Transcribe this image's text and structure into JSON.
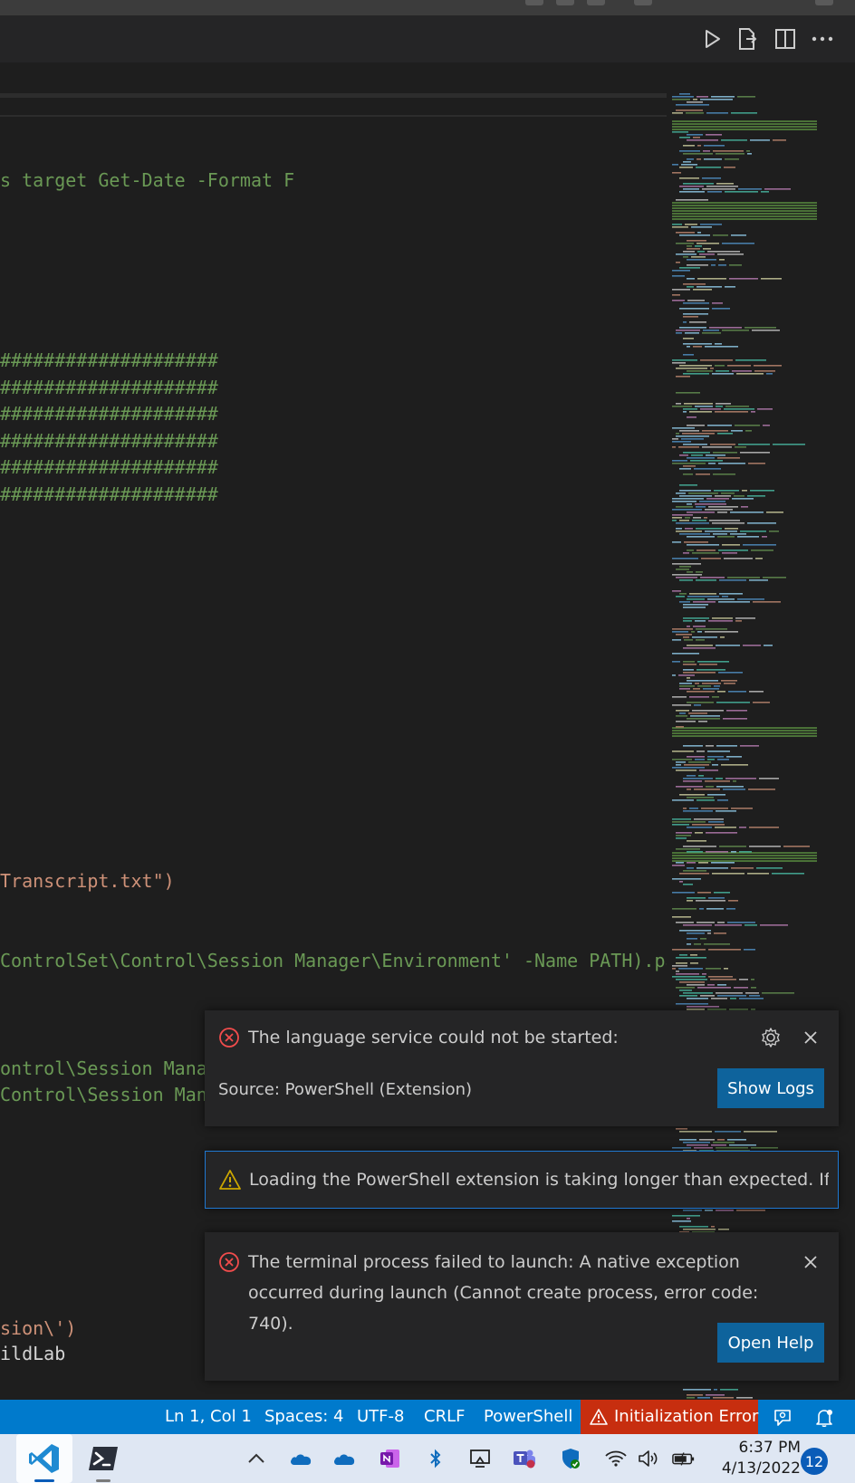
{
  "editor": {
    "code_lines": [
      {
        "text": "s target Get-Date -Format F",
        "color": "#6a9955"
      },
      {
        "text": "####################",
        "color": "#6a9955"
      },
      {
        "text": "####################",
        "color": "#6a9955"
      },
      {
        "text": "####################",
        "color": "#6a9955"
      },
      {
        "text": "####################",
        "color": "#6a9955"
      },
      {
        "text": "####################",
        "color": "#6a9955"
      },
      {
        "text": "####################",
        "color": "#6a9955"
      },
      {
        "text": "Transcript.txt\")",
        "color": "#ce9178"
      },
      {
        "text": "ControlSet\\Control\\Session Manager\\Environment' -Name PATH).pa",
        "color": "#6a9955"
      },
      {
        "text": "ontrol\\Session Mana",
        "color": "#6a9955"
      },
      {
        "text": "Control\\Session Manager\\Environment' -Name PATH).Path",
        "color": "#6a9955"
      },
      {
        "text": "sion\\')",
        "color": "#ce9178"
      },
      {
        "text": "ildLab",
        "color": "#d4d4d4"
      }
    ]
  },
  "editor_actions": {
    "icons": [
      "run-icon",
      "open-changes-icon",
      "split-editor-icon",
      "more-actions-icon"
    ]
  },
  "notifications": {
    "language_service": {
      "message": "The language service could not be started:",
      "source": "Source: PowerShell (Extension)",
      "button": "Show Logs"
    },
    "loading": {
      "message": "Loading the PowerShell extension is taking longer than expected. If yo..."
    },
    "terminal": {
      "message": "The terminal process failed to launch: A native exception occurred during launch (Cannot create process, error code: 740).",
      "button": "Open Help"
    }
  },
  "statusbar": {
    "position": "Ln 1, Col 1",
    "spaces": "Spaces: 4",
    "encoding": "UTF-8",
    "eol": "CRLF",
    "language": "PowerShell",
    "error": "Initialization Error",
    "accent": "#007acc",
    "error_bg": "#c72e0f"
  },
  "taskbar": {
    "time": "6:37 PM",
    "date": "4/13/2022",
    "notification_count": "12",
    "apps": [
      "vscode-icon",
      "powershell-icon"
    ],
    "tray_icons": [
      "chevron-up-icon",
      "onedrive-icon",
      "onedrive-icon",
      "onenote-icon",
      "bluetooth-icon",
      "display-icon",
      "teams-icon",
      "defender-icon",
      "wifi-icon",
      "volume-icon",
      "battery-icon"
    ]
  }
}
